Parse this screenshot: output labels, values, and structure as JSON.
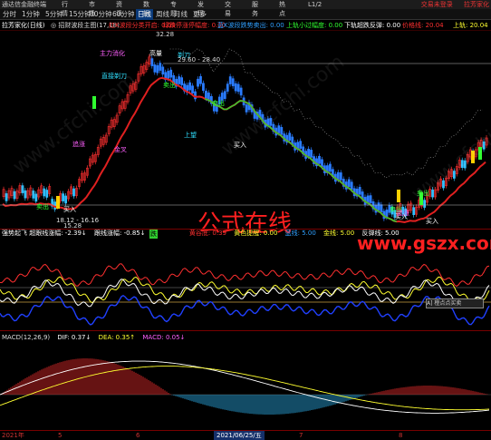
{
  "menubar": {
    "title": "通达信金融终端",
    "right": [
      "交易未登录",
      "拉芳家化"
    ]
  },
  "toolbar": {
    "items": [
      "分时",
      "1分钟",
      "5分钟",
      "15分钟",
      "30分钟",
      "60分钟",
      "日线",
      "周线",
      "月线",
      "更多"
    ],
    "menus": [
      "行情",
      "市场",
      "资讯",
      "数据",
      "专题",
      "发现",
      "交易",
      "服务",
      "热点"
    ],
    "version": "L1/2",
    "active": "日线"
  },
  "titlebar": {
    "stock": "拉芳家化(日线)",
    "formula": "◎ 招财波段主图(17,18)",
    "items": [
      {
        "text": "红K波段分类开启: 0.00",
        "color": "#ff3030"
      },
      {
        "text": "绿跌停涨停幅度: 0.00",
        "color": "#ff3030"
      },
      {
        "text": "蓝K波段跌势卖出: 0.00",
        "color": "#30a0ff"
      },
      {
        "text": "上轨小过幅度: 0.00",
        "color": "#30ff30"
      },
      {
        "text": "下轨超跌反弹: 0.00",
        "color": "#ffffff"
      },
      {
        "text": "价格线: 20.04",
        "color": "#ff3030"
      },
      {
        "text": "上轨: 20.04",
        "color": "#ffff30"
      }
    ]
  },
  "main": {
    "labels": [
      {
        "t": "32.28",
        "c": "#ddd"
      },
      {
        "t": "高量",
        "c": "#fff"
      },
      {
        "t": "主力消化",
        "c": "#ff60ff"
      },
      {
        "t": "直接剃刀",
        "c": "#30e0ff"
      },
      {
        "t": "剃刀",
        "c": "#30e0ff"
      },
      {
        "t": "卖出",
        "c": "#30ff30"
      },
      {
        "t": "29.60 - 28.40",
        "c": "#ddd"
      },
      {
        "t": "追涨",
        "c": "#ff60ff"
      },
      {
        "t": "金叉",
        "c": "#ff60ff"
      },
      {
        "t": "上望",
        "c": "#30e0ff"
      },
      {
        "t": "卖出",
        "c": "#30ff30"
      },
      {
        "t": "买入",
        "c": "#fff"
      },
      {
        "t": "卖出",
        "c": "#30ff30"
      },
      {
        "t": "买入",
        "c": "#fff"
      },
      {
        "t": "18.12 - 16.16",
        "c": "#ddd"
      },
      {
        "t": "15.28",
        "c": "#ddd"
      },
      {
        "t": "卖出",
        "c": "#30ff30"
      },
      {
        "t": "买入",
        "c": "#fff"
      },
      {
        "t": "追涨",
        "c": "#ff60ff"
      },
      {
        "t": "卖出",
        "c": "#30ff30"
      },
      {
        "t": "买入",
        "c": "#fff"
      },
      {
        "t": "公式在线",
        "c": "#ff2020"
      },
      {
        "t": "www.gszx.com",
        "c": "#ff2020"
      }
    ],
    "watermark": "www.cfchi.com"
  },
  "ind1": {
    "title": [
      {
        "t": "强势起飞  超跟线涨幅: -2.39↓",
        "c": "#fff"
      },
      {
        "t": "跟线涨幅: -0.85↓",
        "c": "#fff"
      },
      {
        "t": "黄谷底: 0.39",
        "c": "#ff3030"
      },
      {
        "t": "黄色提醒: 0.00",
        "c": "#ffff30"
      },
      {
        "t": "蓝线: 5.00",
        "c": "#30a0ff"
      },
      {
        "t": "金线: 5.00",
        "c": "#ffff30"
      },
      {
        "t": "反弹线: 5.00",
        "c": "#fff"
      }
    ],
    "flag": "跌",
    "ctrl": "A] 橙点点买卖"
  },
  "ind2": {
    "title": [
      {
        "t": "MACD(12,26,9)",
        "c": "#ddd"
      },
      {
        "t": "DIF: 0.37↓",
        "c": "#fff"
      },
      {
        "t": "DEA: 0.35↑",
        "c": "#ffff30"
      },
      {
        "t": "MACD: 0.05↓",
        "c": "#ff60ff"
      }
    ]
  },
  "timeaxis": {
    "ticks": [
      "2021年",
      "5",
      "6",
      "7",
      "8"
    ],
    "date": "2021/06/25/五"
  },
  "colors": {
    "up": "#ff3030",
    "down": "#30a0ff",
    "ma": "#ff3030",
    "ma2": "#30d030",
    "bg": "#000000"
  }
}
